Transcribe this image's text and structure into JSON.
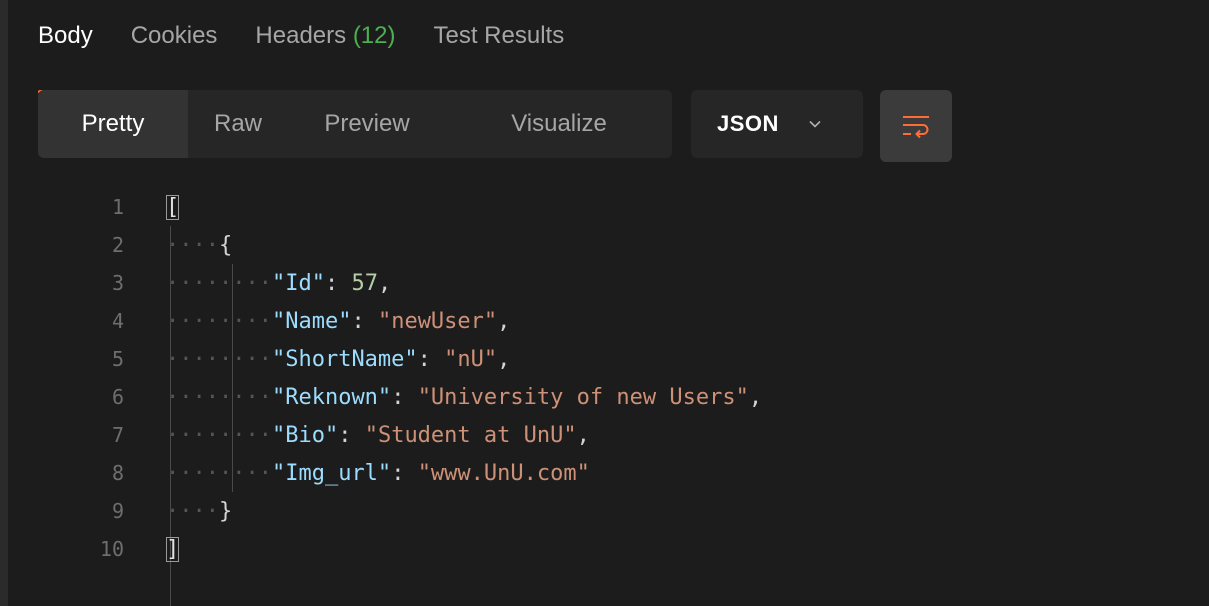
{
  "tabs": [
    {
      "label": "Body",
      "active": true
    },
    {
      "label": "Cookies",
      "active": false
    },
    {
      "label": "Headers",
      "count": "(12)",
      "active": false
    },
    {
      "label": "Test Results",
      "active": false
    }
  ],
  "view_modes": [
    "Pretty",
    "Raw",
    "Preview",
    "Visualize"
  ],
  "active_view_mode": "Pretty",
  "format": "JSON",
  "icons": {
    "wrap": "wrap-lines-icon",
    "dropdown": "chevron-down-icon"
  },
  "colors": {
    "accent": "#ff6c37",
    "count": "#4caf50",
    "key": "#9cdcfe",
    "string": "#ce9178",
    "number": "#b5cea8"
  },
  "code": {
    "line_numbers": [
      "1",
      "2",
      "3",
      "4",
      "5",
      "6",
      "7",
      "8",
      "9",
      "10"
    ],
    "open_array": "[",
    "open_object": "{",
    "close_object": "}",
    "close_array": "]",
    "fields": [
      {
        "key": "\"Id\"",
        "value": "57",
        "type": "number",
        "trailing": ","
      },
      {
        "key": "\"Name\"",
        "value": "\"newUser\"",
        "type": "string",
        "trailing": ","
      },
      {
        "key": "\"ShortName\"",
        "value": "\"nU\"",
        "type": "string",
        "trailing": ","
      },
      {
        "key": "\"Reknown\"",
        "value": "\"University of new Users\"",
        "type": "string",
        "trailing": ","
      },
      {
        "key": "\"Bio\"",
        "value": "\"Student at UnU\"",
        "type": "string",
        "trailing": ","
      },
      {
        "key": "\"Img_url\"",
        "value": "\"www.UnU.com\"",
        "type": "string",
        "trailing": ""
      }
    ]
  }
}
